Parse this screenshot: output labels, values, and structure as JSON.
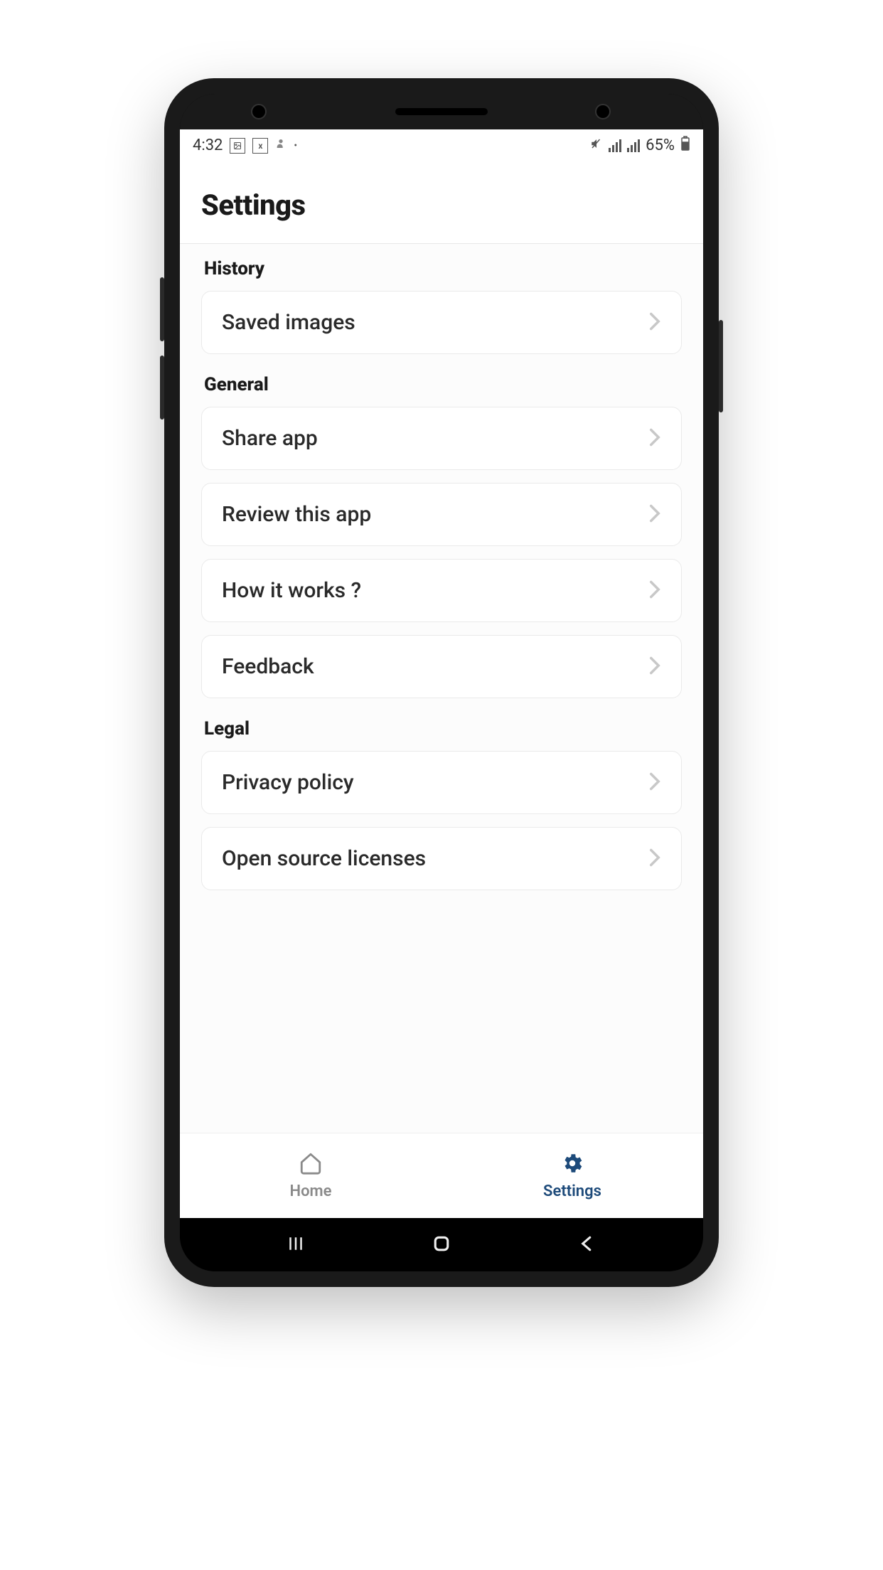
{
  "status_bar": {
    "time": "4:32",
    "battery": "65%"
  },
  "header": {
    "title": "Settings"
  },
  "sections": [
    {
      "title": "History",
      "items": [
        {
          "label": "Saved images",
          "name": "saved-images-item"
        }
      ]
    },
    {
      "title": "General",
      "items": [
        {
          "label": "Share app",
          "name": "share-app-item"
        },
        {
          "label": "Review this app",
          "name": "review-app-item"
        },
        {
          "label": "How it works ?",
          "name": "how-it-works-item"
        },
        {
          "label": "Feedback",
          "name": "feedback-item"
        }
      ]
    },
    {
      "title": "Legal",
      "items": [
        {
          "label": "Privacy policy",
          "name": "privacy-policy-item"
        },
        {
          "label": "Open source licenses",
          "name": "open-source-licenses-item"
        }
      ]
    }
  ],
  "bottom_nav": {
    "home": "Home",
    "settings": "Settings",
    "active": "settings",
    "accent_color": "#1d4a7a"
  }
}
